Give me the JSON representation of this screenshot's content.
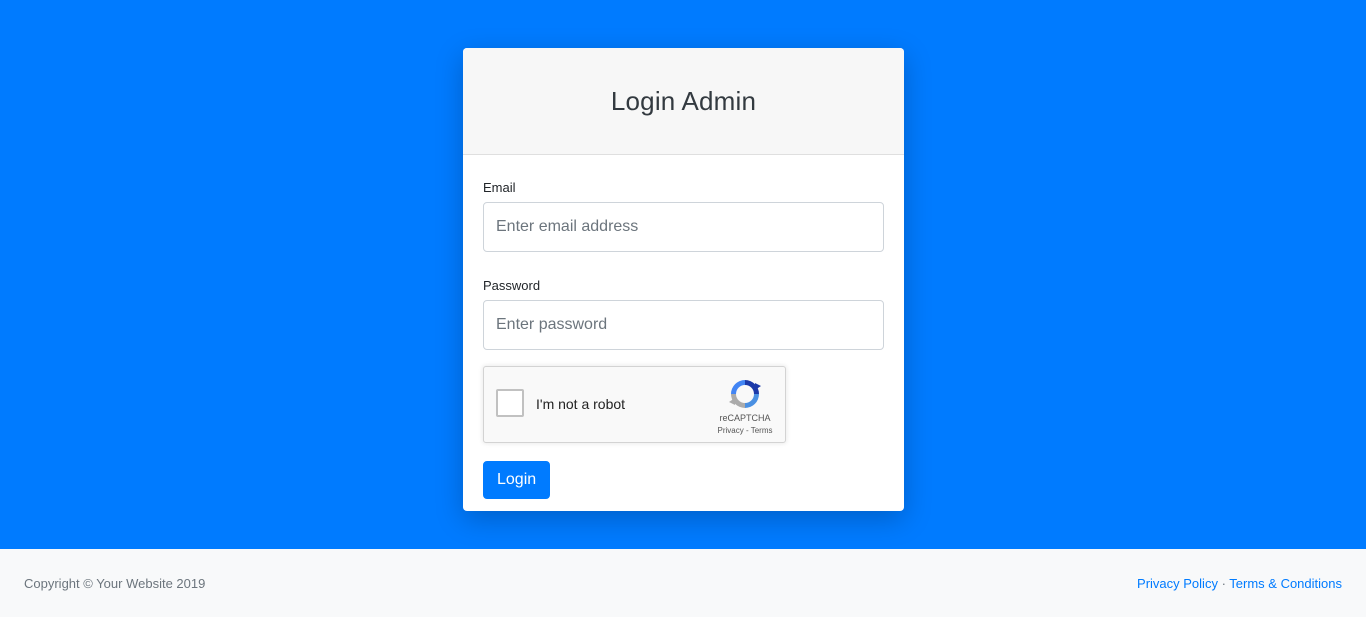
{
  "card": {
    "title": "Login Admin"
  },
  "form": {
    "email_label": "Email",
    "email_placeholder": "Enter email address",
    "email_value": "",
    "password_label": "Password",
    "password_placeholder": "Enter password",
    "password_value": "",
    "login_label": "Login"
  },
  "recaptcha": {
    "label": "I'm not a robot",
    "brand": "reCAPTCHA",
    "privacy": "Privacy",
    "separator": " - ",
    "terms": "Terms",
    "checked": false,
    "icon": "recaptcha-logo-icon"
  },
  "footer": {
    "copyright": "Copyright © Your Website 2019",
    "privacy_link": "Privacy Policy",
    "separator": " · ",
    "terms_link": "Terms & Conditions"
  },
  "colors": {
    "primary": "#007bff",
    "footer_bg": "#f8f9fa",
    "card_header_bg": "#f7f7f7"
  }
}
